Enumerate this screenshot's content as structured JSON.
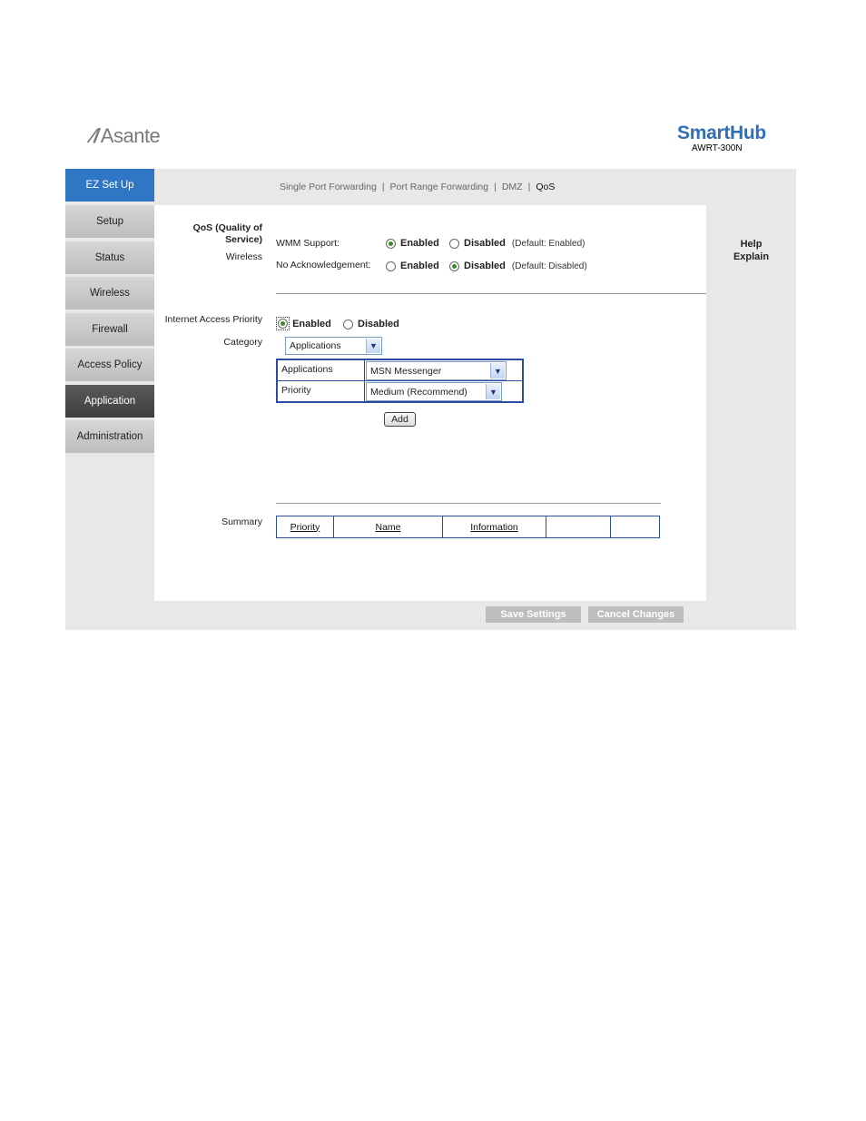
{
  "brand": {
    "company": "Asante",
    "product": "SmartHub",
    "model": "AWRT-300N"
  },
  "nav": [
    {
      "label": "EZ Set Up"
    },
    {
      "label": "Setup"
    },
    {
      "label": "Status"
    },
    {
      "label": "Wireless"
    },
    {
      "label": "Firewall"
    },
    {
      "label": "Access Policy"
    },
    {
      "label": "Application"
    },
    {
      "label": "Administration"
    }
  ],
  "tabs": {
    "items": [
      "Single Port Forwarding",
      "Port Range Forwarding",
      "DMZ",
      "QoS"
    ],
    "separator": "|",
    "current": "QoS"
  },
  "help": {
    "line1": "Help",
    "line2": "Explain"
  },
  "qos": {
    "section_title_1": "QoS (Quality of",
    "section_title_2": "Service)",
    "wireless_label": "Wireless",
    "wmm_label": "WMM Support:",
    "wmm_enabled": "Enabled",
    "wmm_disabled": "Disabled",
    "wmm_default": "(Default: Enabled)",
    "wmm_value": "Enabled",
    "noack_label": "No Acknowledgement:",
    "noack_enabled": "Enabled",
    "noack_disabled": "Disabled",
    "noack_default": "(Default: Disabled)",
    "noack_value": "Disabled"
  },
  "iap": {
    "label": "Internet Access Priority",
    "enabled": "Enabled",
    "disabled": "Disabled",
    "value": "Enabled",
    "category_label": "Category",
    "category_value": "Applications",
    "applications_label": "Applications",
    "applications_value": "MSN Messenger",
    "priority_label": "Priority",
    "priority_value": "Medium (Recommend)",
    "add_button": "Add"
  },
  "summary": {
    "label": "Summary",
    "columns": [
      "Priority",
      "Name",
      "Information",
      "",
      ""
    ]
  },
  "footer": {
    "save": "Save Settings",
    "cancel": "Cancel Changes"
  },
  "colors": {
    "brand_blue": "#2f6fb8",
    "active_nav_blue": "#2f77c4",
    "active_nav_dark": "#4a4a4a",
    "radio_on": "#3a8a2a"
  }
}
